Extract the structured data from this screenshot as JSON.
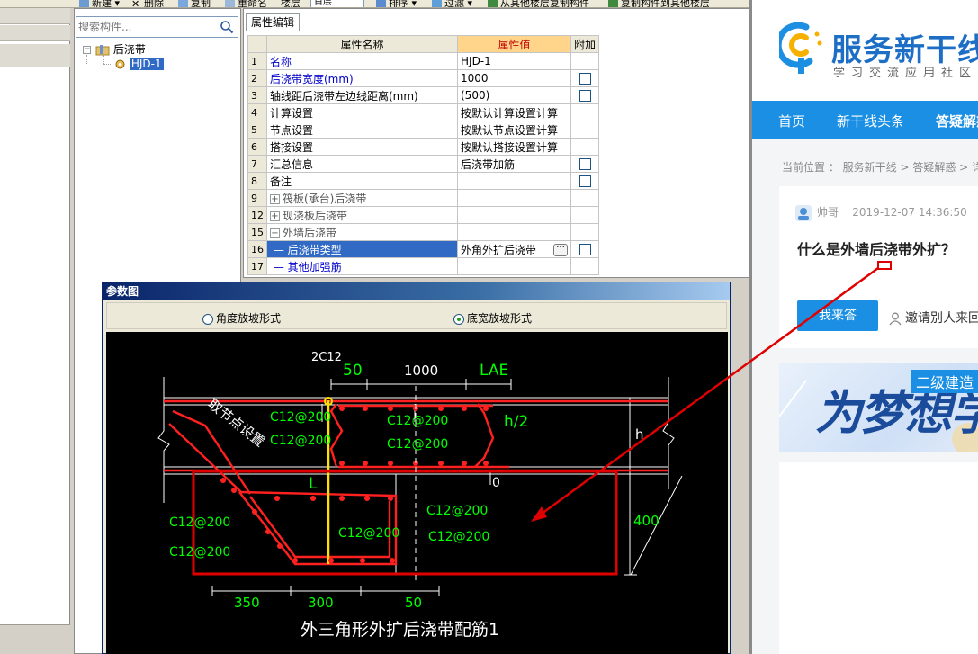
{
  "toolbar": {
    "new_label": "新建",
    "delete_label": "删除",
    "copy_label": "复制",
    "rename_label": "重命名",
    "floor_label": "楼层",
    "floor_value": "首层",
    "sort_label": "排序",
    "filter_label": "过滤",
    "copy_from_floor_label": "从其他楼层复制构件",
    "copy_to_floor_label": "复制构件到其他楼层"
  },
  "tree": {
    "search_placeholder": "搜索构件...",
    "root_label": "后浇带",
    "child_label": "HJD-1"
  },
  "props": {
    "tab_label": "属性编辑",
    "col_name": "属性名称",
    "col_value": "属性值",
    "col_add": "附加",
    "rows": [
      {
        "num": "1",
        "name": "名称",
        "value": "HJD-1"
      },
      {
        "num": "2",
        "name": "后浇带宽度(mm)",
        "value": "1000"
      },
      {
        "num": "3",
        "name": "轴线距后浇带左边线距离(mm)",
        "value": "(500)"
      },
      {
        "num": "4",
        "name": "计算设置",
        "value": "按默认计算设置计算"
      },
      {
        "num": "5",
        "name": "节点设置",
        "value": "按默认节点设置计算"
      },
      {
        "num": "6",
        "name": "搭接设置",
        "value": "按默认搭接设置计算"
      },
      {
        "num": "7",
        "name": "汇总信息",
        "value": "后浇带加筋"
      },
      {
        "num": "8",
        "name": "备注",
        "value": ""
      },
      {
        "num": "9",
        "name": "筏板(承台)后浇带",
        "value": ""
      },
      {
        "num": "12",
        "name": "现浇板后浇带",
        "value": ""
      },
      {
        "num": "15",
        "name": "外墙后浇带",
        "value": ""
      },
      {
        "num": "16",
        "name": "后浇带类型",
        "value": "外角外扩后浇带"
      },
      {
        "num": "17",
        "name": "其他加强筋",
        "value": ""
      }
    ]
  },
  "param": {
    "title": "参数图",
    "option1": "角度放坡形式",
    "option2": "底宽放坡形式",
    "caption": "外三角形外扩后浇带配筋1",
    "labels": {
      "top_bar": "2C12",
      "d50_top": "50",
      "d1000": "1000",
      "lae": "LAE",
      "h2": "h/2",
      "h": "h",
      "zero": "0",
      "L": "L",
      "node": "取节点设置",
      "c12_a": "C12@200",
      "c12_b": "C12@200",
      "c12_c": "C12@200",
      "c12_d": "C12@200",
      "c12_e": "C12@200",
      "c12_f": "C12@200",
      "c12_g": "C12@200",
      "c12_h": "C12@200",
      "c12_i": "C12@200",
      "d400": "400",
      "d350": "350",
      "d300": "300",
      "d50_bot": "50"
    }
  },
  "site": {
    "logo_text": "服务新干线",
    "slogan": "学习交流应用社区",
    "nav": [
      "首页",
      "新干线头条",
      "答疑解惑"
    ],
    "breadcrumb": "当前位置 ： 服务新干线 > 答疑解惑 > 详",
    "author": "帅哥",
    "date": "2019-12-07 14:36:50",
    "question": "什么是外墙后浇带外扩？",
    "answer_button": "我来答",
    "invite": "邀请别人来回",
    "banner_text": "为梦想学",
    "banner_tag": "二级建造"
  },
  "colors": {
    "accent_blue": "#1a8fe3",
    "annotation_red": "#e00000",
    "cad_green": "#00ff00",
    "cad_red": "#ff2020"
  }
}
